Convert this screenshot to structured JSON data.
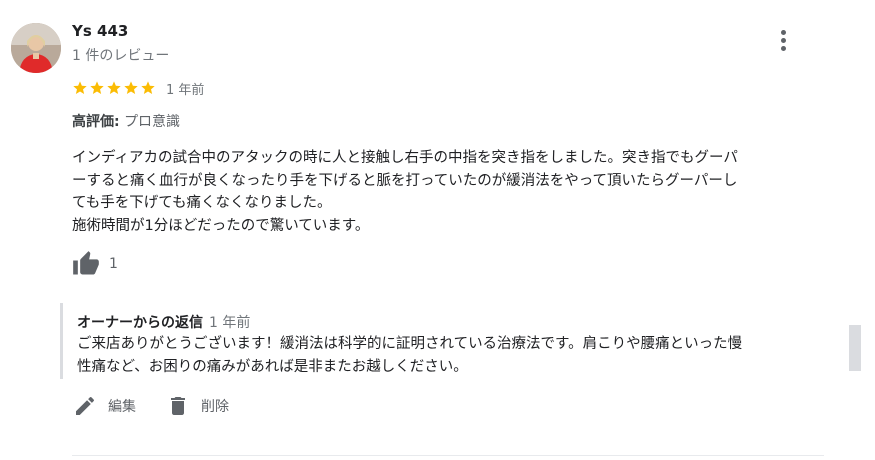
{
  "review": {
    "author": {
      "name": "Ys 443",
      "review_count": "1 件のレビュー"
    },
    "rating": 5,
    "star_color": "#fbbc04",
    "date": "1 年前",
    "highlight": {
      "label": "高評価:",
      "value": "プロ意識"
    },
    "text_lines": [
      "インディアカの試合中のアタックの時に人と接触し右手の中指を突き指をしました。突き指でもグーパ",
      "ーすると痛く血行が良くなったり手を下げると脈を打っていたのが緩消法をやって頂いたらグーパーし",
      "ても手を下げても痛くなくなりました。",
      "施術時間が1分ほどだったので驚いています。"
    ],
    "like_count": "1"
  },
  "owner_reply": {
    "title": "オーナーからの返信",
    "date": "1 年前",
    "text_lines": [
      "ご来店ありがとうございます！緩消法は科学的に証明されている治療法です。肩こりや腰痛といった慢",
      "性痛など、お困りの痛みがあれば是非またお越しください。"
    ]
  },
  "actions": {
    "edit_label": "編集",
    "delete_label": "削除"
  },
  "icons": {
    "more": "more-vert-icon",
    "like": "thumb-up-icon",
    "edit": "pencil-icon",
    "delete": "trash-icon",
    "star": "star-icon"
  }
}
